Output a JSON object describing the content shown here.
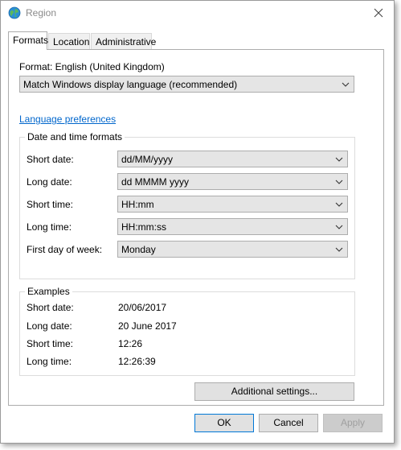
{
  "window": {
    "title": "Region"
  },
  "tabs": [
    {
      "label": "Formats",
      "active": true
    },
    {
      "label": "Location",
      "active": false
    },
    {
      "label": "Administrative",
      "active": false
    }
  ],
  "formats": {
    "format_label": "Format: English (United Kingdom)",
    "format_value": "Match Windows display language (recommended)",
    "language_link": "Language preferences",
    "date_time_group": {
      "title": "Date and time formats",
      "rows": [
        {
          "label": "Short date:",
          "value": "dd/MM/yyyy"
        },
        {
          "label": "Long date:",
          "value": "dd MMMM yyyy"
        },
        {
          "label": "Short time:",
          "value": "HH:mm"
        },
        {
          "label": "Long time:",
          "value": "HH:mm:ss"
        },
        {
          "label": "First day of week:",
          "value": "Monday"
        }
      ]
    },
    "examples_group": {
      "title": "Examples",
      "rows": [
        {
          "label": "Short date:",
          "value": "20/06/2017"
        },
        {
          "label": "Long date:",
          "value": "20 June 2017"
        },
        {
          "label": "Short time:",
          "value": "12:26"
        },
        {
          "label": "Long time:",
          "value": "12:26:39"
        }
      ]
    },
    "additional_settings": "Additional settings..."
  },
  "footer": {
    "ok": "OK",
    "cancel": "Cancel",
    "apply": "Apply",
    "apply_enabled": false
  },
  "icons": {
    "window_icon": "globe-icon",
    "close": "close-icon",
    "dropdown": "chevron-down-icon"
  },
  "colors": {
    "link": "#0066cc",
    "primary_button_border": "#0078d7",
    "disabled_text": "#a0a0a0"
  }
}
